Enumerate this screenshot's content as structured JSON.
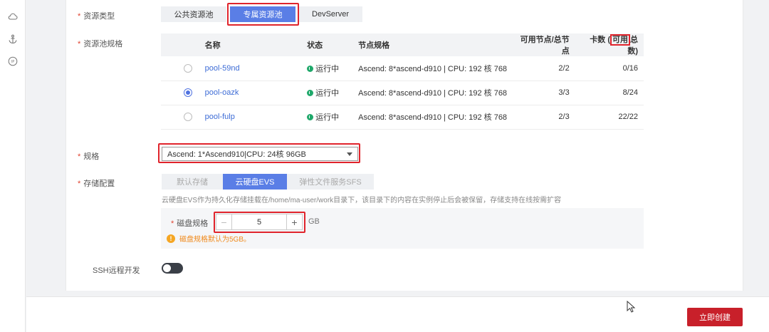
{
  "form": {
    "resource_type": {
      "label": "资源类型",
      "options": [
        "公共资源池",
        "专属资源池",
        "DevServer"
      ],
      "selected": "专属资源池"
    },
    "pool_spec": {
      "label": "资源池规格",
      "columns": [
        "名称",
        "状态",
        "节点规格",
        "可用节点/总节点",
        "卡数 (",
        "可用",
        "总数)"
      ],
      "rows": [
        {
          "name": "pool-59nd",
          "status": "运行中",
          "spec": "Ascend: 8*ascend-d910 | CPU: 192 核 768",
          "nodes": "2/2",
          "cards": "0/16",
          "selected": false
        },
        {
          "name": "pool-oazk",
          "status": "运行中",
          "spec": "Ascend: 8*ascend-d910 | CPU: 192 核 768",
          "nodes": "3/3",
          "cards": "8/24",
          "selected": true
        },
        {
          "name": "pool-fulp",
          "status": "运行中",
          "spec": "Ascend: 8*ascend-d910 | CPU: 192 核 768",
          "nodes": "2/3",
          "cards": "22/22",
          "selected": false
        }
      ]
    },
    "flavor": {
      "label": "规格",
      "value": "Ascend: 1*Ascend910|CPU: 24核 96GB"
    },
    "storage": {
      "label": "存储配置",
      "options": [
        "默认存储",
        "云硬盘EVS",
        "弹性文件服务SFS"
      ],
      "selected": "云硬盘EVS",
      "hint": "云硬盘EVS作为持久化存储挂载在/home/ma-user/work目录下，该目录下的内容在实例停止后会被保留，存储支持在线按需扩容",
      "disk_label": "磁盘规格",
      "disk_value": "5",
      "disk_unit": "GB",
      "warning": "磁盘规格默认为5GB。"
    },
    "ssh": {
      "label": "SSH远程开发",
      "enabled": false
    }
  },
  "footer": {
    "create_label": "立即创建"
  },
  "colors": {
    "primary": "#5a7ee6",
    "danger": "#c8202a",
    "highlight": "#e0242c",
    "running": "#1fa86a",
    "warning": "#f08a1c"
  }
}
